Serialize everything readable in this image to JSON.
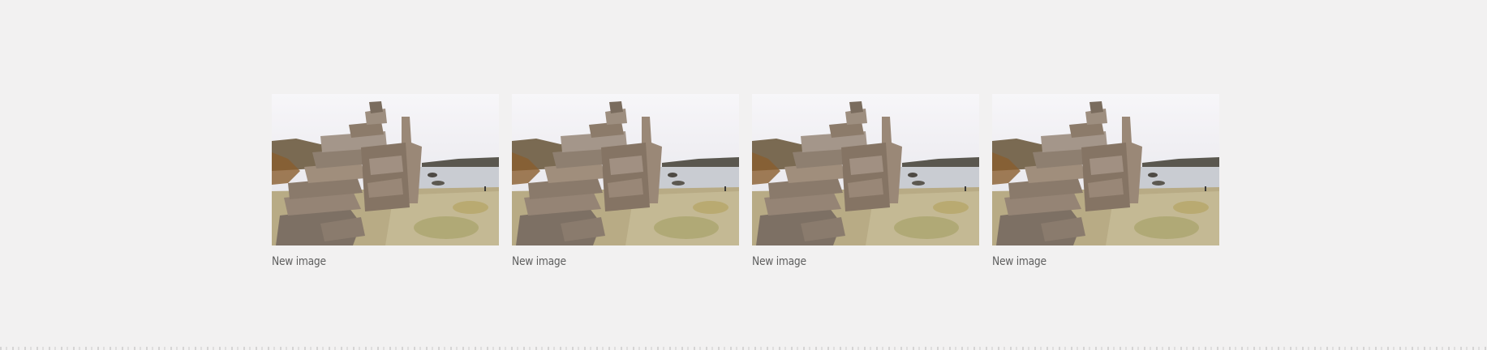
{
  "gallery": {
    "items": [
      {
        "caption": "New image",
        "image_alt": "Stacked stone cairn beside a lake"
      },
      {
        "caption": "New image",
        "image_alt": "Stacked stone cairn beside a lake"
      },
      {
        "caption": "New image",
        "image_alt": "Stacked stone cairn beside a lake"
      },
      {
        "caption": "New image",
        "image_alt": "Stacked stone cairn beside a lake"
      }
    ]
  },
  "colors": {
    "background": "#f2f1f1",
    "caption": "#5f5f5f"
  }
}
